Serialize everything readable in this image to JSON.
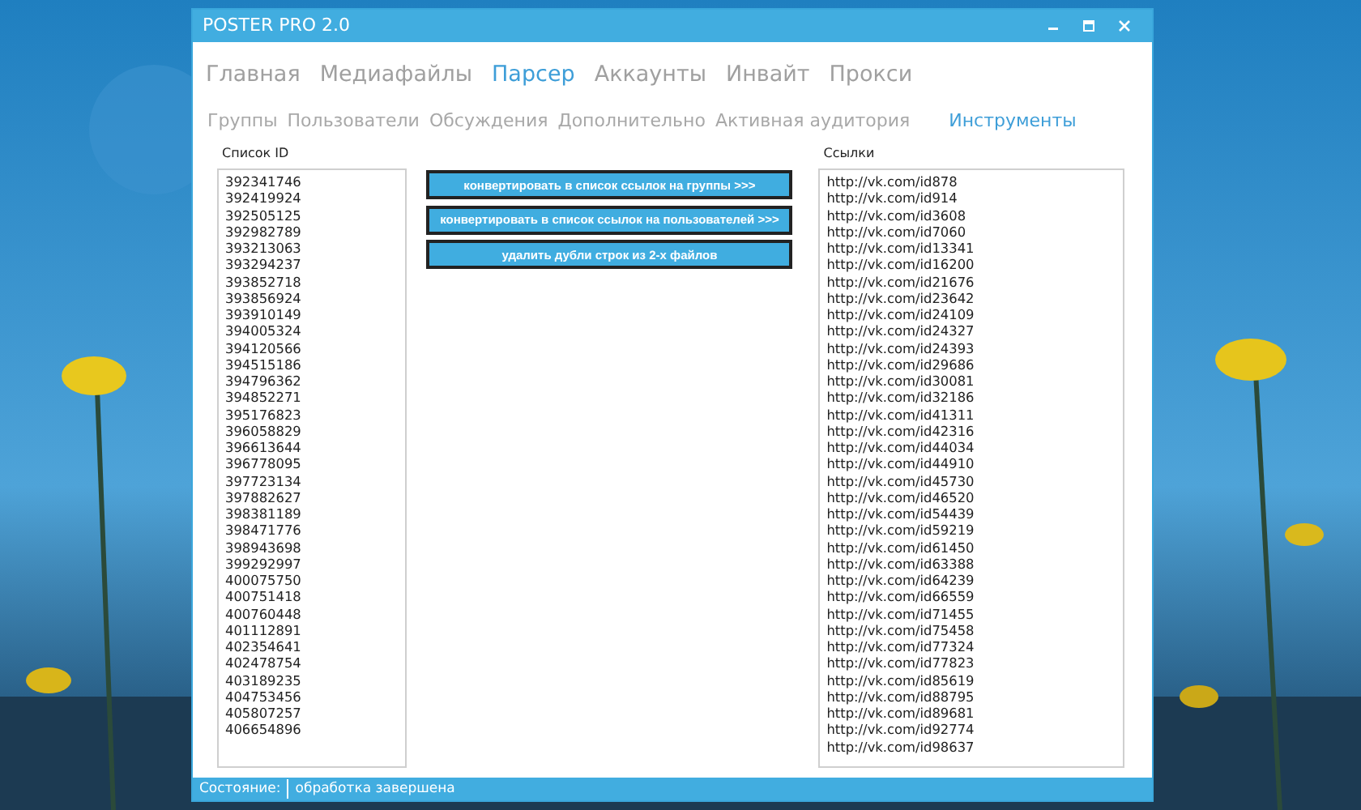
{
  "window": {
    "title": "POSTER PRO 2.0"
  },
  "main_tabs": [
    {
      "label": "Главная",
      "selected": false
    },
    {
      "label": "Медиафайлы",
      "selected": false
    },
    {
      "label": "Парсер",
      "selected": true
    },
    {
      "label": "Аккаунты",
      "selected": false
    },
    {
      "label": "Инвайт",
      "selected": false
    },
    {
      "label": "Прокси",
      "selected": false
    }
  ],
  "sub_tabs": [
    {
      "label": "Группы",
      "selected": false
    },
    {
      "label": "Пользователи",
      "selected": false
    },
    {
      "label": "Обсуждения",
      "selected": false
    },
    {
      "label": "Дополнительно",
      "selected": false
    },
    {
      "label": "Активная аудитория",
      "selected": false
    },
    {
      "label": "Инструменты",
      "selected": true
    }
  ],
  "id_list": {
    "label": "Список ID",
    "items": [
      "392341746",
      "392419924",
      "392505125",
      "392982789",
      "393213063",
      "393294237",
      "393852718",
      "393856924",
      "393910149",
      "394005324",
      "394120566",
      "394515186",
      "394796362",
      "394852271",
      "395176823",
      "396058829",
      "396613644",
      "396778095",
      "397723134",
      "397882627",
      "398381189",
      "398471776",
      "398943698",
      "399292997",
      "400075750",
      "400751418",
      "400760448",
      "401112891",
      "402354641",
      "402478754",
      "403189235",
      "404753456",
      "405807257",
      "406654896"
    ]
  },
  "buttons": [
    "конвертировать в список ссылок на группы >>>",
    "конвертировать в список ссылок на пользователей >>>",
    "удалить дубли строк из 2-х файлов"
  ],
  "links_list": {
    "label": "Ссылки",
    "items": [
      "http://vk.com/id878",
      "http://vk.com/id914",
      "http://vk.com/id3608",
      "http://vk.com/id7060",
      "http://vk.com/id13341",
      "http://vk.com/id16200",
      "http://vk.com/id21676",
      "http://vk.com/id23642",
      "http://vk.com/id24109",
      "http://vk.com/id24327",
      "http://vk.com/id24393",
      "http://vk.com/id29686",
      "http://vk.com/id30081",
      "http://vk.com/id32186",
      "http://vk.com/id41311",
      "http://vk.com/id42316",
      "http://vk.com/id44034",
      "http://vk.com/id44910",
      "http://vk.com/id45730",
      "http://vk.com/id46520",
      "http://vk.com/id54439",
      "http://vk.com/id59219",
      "http://vk.com/id61450",
      "http://vk.com/id63388",
      "http://vk.com/id64239",
      "http://vk.com/id66559",
      "http://vk.com/id71455",
      "http://vk.com/id75458",
      "http://vk.com/id77324",
      "http://vk.com/id77823",
      "http://vk.com/id85619",
      "http://vk.com/id88795",
      "http://vk.com/id89681",
      "http://vk.com/id92774",
      "http://vk.com/id98637"
    ]
  },
  "status_bar": {
    "label": "Состояние:",
    "value": "обработка завершена"
  }
}
